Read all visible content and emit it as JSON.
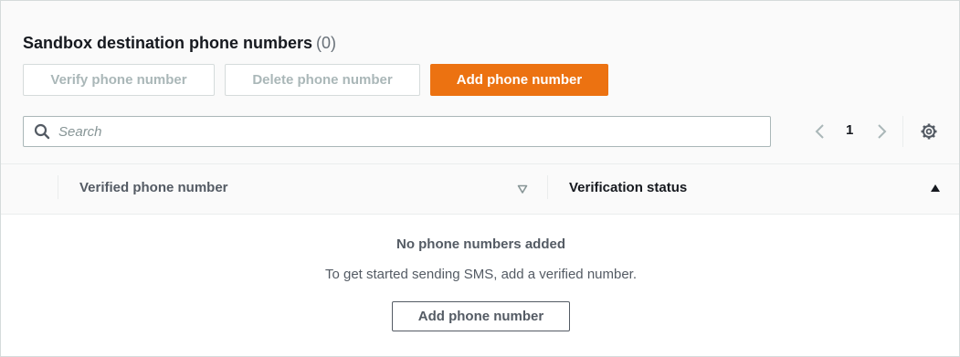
{
  "header": {
    "title": "Sandbox destination phone numbers",
    "count": "(0)"
  },
  "actions": {
    "verify_label": "Verify phone number",
    "delete_label": "Delete phone number",
    "add_label": "Add phone number"
  },
  "search": {
    "placeholder": "Search"
  },
  "pagination": {
    "current_page": "1"
  },
  "table": {
    "columns": [
      "Verified phone number",
      "Verification status"
    ]
  },
  "empty_state": {
    "title": "No phone numbers added",
    "description": "To get started sending SMS, add a verified number.",
    "button_label": "Add phone number"
  },
  "colors": {
    "primary": "#ec7211",
    "text": "#16191f",
    "muted": "#545b64"
  },
  "icons": [
    "search-icon",
    "chevron-left-icon",
    "chevron-right-icon",
    "settings-gear-icon",
    "sort-desc-icon",
    "sort-asc-icon"
  ]
}
